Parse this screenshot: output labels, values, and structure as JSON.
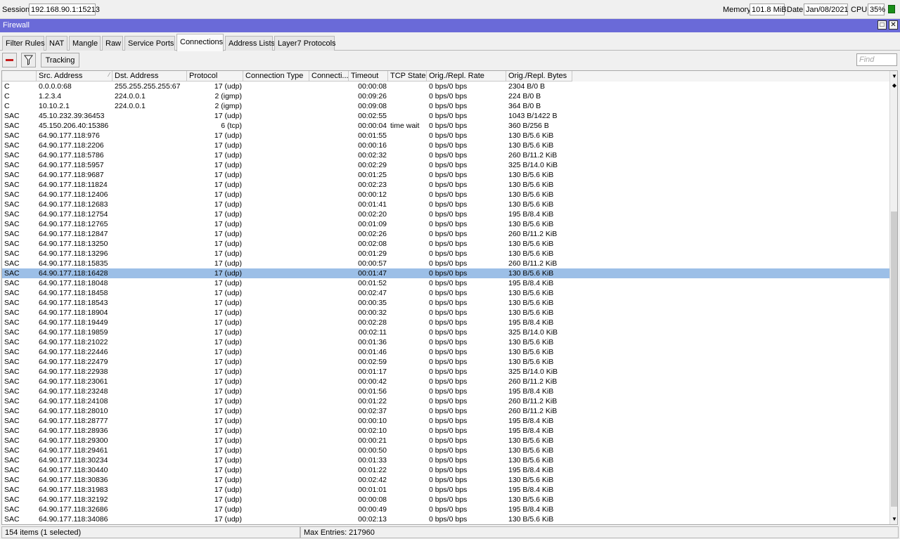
{
  "top": {
    "session_label": "Session:",
    "session_value": "192.168.90.1:15213",
    "memory_label": "Memory:",
    "memory_value": "101.8 MiB",
    "date_label": "Date:",
    "date_value": "Jan/08/2021",
    "cpu_label": "CPU:",
    "cpu_value": "35%"
  },
  "window": {
    "title": "Firewall"
  },
  "tabs": [
    {
      "label": "Filter Rules"
    },
    {
      "label": "NAT"
    },
    {
      "label": "Mangle"
    },
    {
      "label": "Raw"
    },
    {
      "label": "Service Ports"
    },
    {
      "label": "Connections"
    },
    {
      "label": "Address Lists"
    },
    {
      "label": "Layer7 Protocols"
    }
  ],
  "toolbar": {
    "tracking_label": "Tracking",
    "find_placeholder": "Find"
  },
  "columns": [
    "",
    "Src. Address",
    "Dst. Address",
    "Protocol",
    "Connection Type",
    "Connecti...",
    "Timeout",
    "TCP State",
    "Orig./Repl. Rate",
    "Orig./Repl. Bytes"
  ],
  "rows": [
    {
      "f": "C",
      "src": "0.0.0.0:68",
      "dst": "255.255.255.255:67",
      "proto": "17 (udp)",
      "tcp": "",
      "timeout": "00:00:08",
      "rate": "0 bps/0 bps",
      "bytes": "2304 B/0 B"
    },
    {
      "f": "C",
      "src": "1.2.3.4",
      "dst": "224.0.0.1",
      "proto": "2 (igmp)",
      "tcp": "",
      "timeout": "00:09:26",
      "rate": "0 bps/0 bps",
      "bytes": "224 B/0 B"
    },
    {
      "f": "C",
      "src": "10.10.2.1",
      "dst": "224.0.0.1",
      "proto": "2 (igmp)",
      "tcp": "",
      "timeout": "00:09:08",
      "rate": "0 bps/0 bps",
      "bytes": "364 B/0 B"
    },
    {
      "f": "SAC",
      "src": "45.10.232.39:36453",
      "dst": "",
      "proto": "17 (udp)",
      "tcp": "",
      "timeout": "00:02:55",
      "rate": "0 bps/0 bps",
      "bytes": "1043 B/1422 B"
    },
    {
      "f": "SAC",
      "src": "45.150.206.40:15386",
      "dst": "",
      "proto": "6 (tcp)",
      "tcp": "time wait",
      "timeout": "00:00:04",
      "rate": "0 bps/0 bps",
      "bytes": "360 B/256 B"
    },
    {
      "f": "SAC",
      "src": "64.90.177.118:976",
      "dst": "",
      "proto": "17 (udp)",
      "tcp": "",
      "timeout": "00:01:55",
      "rate": "0 bps/0 bps",
      "bytes": "130 B/5.6 KiB"
    },
    {
      "f": "SAC",
      "src": "64.90.177.118:2206",
      "dst": "",
      "proto": "17 (udp)",
      "tcp": "",
      "timeout": "00:00:16",
      "rate": "0 bps/0 bps",
      "bytes": "130 B/5.6 KiB"
    },
    {
      "f": "SAC",
      "src": "64.90.177.118:5786",
      "dst": "",
      "proto": "17 (udp)",
      "tcp": "",
      "timeout": "00:02:32",
      "rate": "0 bps/0 bps",
      "bytes": "260 B/11.2 KiB"
    },
    {
      "f": "SAC",
      "src": "64.90.177.118:5957",
      "dst": "",
      "proto": "17 (udp)",
      "tcp": "",
      "timeout": "00:02:29",
      "rate": "0 bps/0 bps",
      "bytes": "325 B/14.0 KiB"
    },
    {
      "f": "SAC",
      "src": "64.90.177.118:9687",
      "dst": "",
      "proto": "17 (udp)",
      "tcp": "",
      "timeout": "00:01:25",
      "rate": "0 bps/0 bps",
      "bytes": "130 B/5.6 KiB"
    },
    {
      "f": "SAC",
      "src": "64.90.177.118:11824",
      "dst": "",
      "proto": "17 (udp)",
      "tcp": "",
      "timeout": "00:02:23",
      "rate": "0 bps/0 bps",
      "bytes": "130 B/5.6 KiB"
    },
    {
      "f": "SAC",
      "src": "64.90.177.118:12406",
      "dst": "",
      "proto": "17 (udp)",
      "tcp": "",
      "timeout": "00:00:12",
      "rate": "0 bps/0 bps",
      "bytes": "130 B/5.6 KiB"
    },
    {
      "f": "SAC",
      "src": "64.90.177.118:12683",
      "dst": "",
      "proto": "17 (udp)",
      "tcp": "",
      "timeout": "00:01:41",
      "rate": "0 bps/0 bps",
      "bytes": "130 B/5.6 KiB"
    },
    {
      "f": "SAC",
      "src": "64.90.177.118:12754",
      "dst": "",
      "proto": "17 (udp)",
      "tcp": "",
      "timeout": "00:02:20",
      "rate": "0 bps/0 bps",
      "bytes": "195 B/8.4 KiB"
    },
    {
      "f": "SAC",
      "src": "64.90.177.118:12765",
      "dst": "",
      "proto": "17 (udp)",
      "tcp": "",
      "timeout": "00:01:09",
      "rate": "0 bps/0 bps",
      "bytes": "130 B/5.6 KiB"
    },
    {
      "f": "SAC",
      "src": "64.90.177.118:12847",
      "dst": "",
      "proto": "17 (udp)",
      "tcp": "",
      "timeout": "00:02:26",
      "rate": "0 bps/0 bps",
      "bytes": "260 B/11.2 KiB"
    },
    {
      "f": "SAC",
      "src": "64.90.177.118:13250",
      "dst": "",
      "proto": "17 (udp)",
      "tcp": "",
      "timeout": "00:02:08",
      "rate": "0 bps/0 bps",
      "bytes": "130 B/5.6 KiB"
    },
    {
      "f": "SAC",
      "src": "64.90.177.118:13296",
      "dst": "",
      "proto": "17 (udp)",
      "tcp": "",
      "timeout": "00:01:29",
      "rate": "0 bps/0 bps",
      "bytes": "130 B/5.6 KiB"
    },
    {
      "f": "SAC",
      "src": "64.90.177.118:15835",
      "dst": "",
      "proto": "17 (udp)",
      "tcp": "",
      "timeout": "00:00:57",
      "rate": "0 bps/0 bps",
      "bytes": "260 B/11.2 KiB"
    },
    {
      "f": "SAC",
      "src": "64.90.177.118:16428",
      "dst": "",
      "proto": "17 (udp)",
      "tcp": "",
      "timeout": "00:01:47",
      "rate": "0 bps/0 bps",
      "bytes": "130 B/5.6 KiB",
      "selected": true
    },
    {
      "f": "SAC",
      "src": "64.90.177.118:18048",
      "dst": "",
      "proto": "17 (udp)",
      "tcp": "",
      "timeout": "00:01:52",
      "rate": "0 bps/0 bps",
      "bytes": "195 B/8.4 KiB"
    },
    {
      "f": "SAC",
      "src": "64.90.177.118:18458",
      "dst": "",
      "proto": "17 (udp)",
      "tcp": "",
      "timeout": "00:02:47",
      "rate": "0 bps/0 bps",
      "bytes": "130 B/5.6 KiB"
    },
    {
      "f": "SAC",
      "src": "64.90.177.118:18543",
      "dst": "",
      "proto": "17 (udp)",
      "tcp": "",
      "timeout": "00:00:35",
      "rate": "0 bps/0 bps",
      "bytes": "130 B/5.6 KiB"
    },
    {
      "f": "SAC",
      "src": "64.90.177.118:18904",
      "dst": "",
      "proto": "17 (udp)",
      "tcp": "",
      "timeout": "00:00:32",
      "rate": "0 bps/0 bps",
      "bytes": "130 B/5.6 KiB"
    },
    {
      "f": "SAC",
      "src": "64.90.177.118:19449",
      "dst": "",
      "proto": "17 (udp)",
      "tcp": "",
      "timeout": "00:02:28",
      "rate": "0 bps/0 bps",
      "bytes": "195 B/8.4 KiB"
    },
    {
      "f": "SAC",
      "src": "64.90.177.118:19859",
      "dst": "",
      "proto": "17 (udp)",
      "tcp": "",
      "timeout": "00:02:11",
      "rate": "0 bps/0 bps",
      "bytes": "325 B/14.0 KiB"
    },
    {
      "f": "SAC",
      "src": "64.90.177.118:21022",
      "dst": "",
      "proto": "17 (udp)",
      "tcp": "",
      "timeout": "00:01:36",
      "rate": "0 bps/0 bps",
      "bytes": "130 B/5.6 KiB"
    },
    {
      "f": "SAC",
      "src": "64.90.177.118:22446",
      "dst": "",
      "proto": "17 (udp)",
      "tcp": "",
      "timeout": "00:01:46",
      "rate": "0 bps/0 bps",
      "bytes": "130 B/5.6 KiB"
    },
    {
      "f": "SAC",
      "src": "64.90.177.118:22479",
      "dst": "",
      "proto": "17 (udp)",
      "tcp": "",
      "timeout": "00:02:59",
      "rate": "0 bps/0 bps",
      "bytes": "130 B/5.6 KiB"
    },
    {
      "f": "SAC",
      "src": "64.90.177.118:22938",
      "dst": "",
      "proto": "17 (udp)",
      "tcp": "",
      "timeout": "00:01:17",
      "rate": "0 bps/0 bps",
      "bytes": "325 B/14.0 KiB"
    },
    {
      "f": "SAC",
      "src": "64.90.177.118:23061",
      "dst": "",
      "proto": "17 (udp)",
      "tcp": "",
      "timeout": "00:00:42",
      "rate": "0 bps/0 bps",
      "bytes": "260 B/11.2 KiB"
    },
    {
      "f": "SAC",
      "src": "64.90.177.118:23248",
      "dst": "",
      "proto": "17 (udp)",
      "tcp": "",
      "timeout": "00:01:56",
      "rate": "0 bps/0 bps",
      "bytes": "195 B/8.4 KiB"
    },
    {
      "f": "SAC",
      "src": "64.90.177.118:24108",
      "dst": "",
      "proto": "17 (udp)",
      "tcp": "",
      "timeout": "00:01:22",
      "rate": "0 bps/0 bps",
      "bytes": "260 B/11.2 KiB"
    },
    {
      "f": "SAC",
      "src": "64.90.177.118:28010",
      "dst": "",
      "proto": "17 (udp)",
      "tcp": "",
      "timeout": "00:02:37",
      "rate": "0 bps/0 bps",
      "bytes": "260 B/11.2 KiB"
    },
    {
      "f": "SAC",
      "src": "64.90.177.118:28777",
      "dst": "",
      "proto": "17 (udp)",
      "tcp": "",
      "timeout": "00:00:10",
      "rate": "0 bps/0 bps",
      "bytes": "195 B/8.4 KiB"
    },
    {
      "f": "SAC",
      "src": "64.90.177.118:28936",
      "dst": "",
      "proto": "17 (udp)",
      "tcp": "",
      "timeout": "00:02:10",
      "rate": "0 bps/0 bps",
      "bytes": "195 B/8.4 KiB"
    },
    {
      "f": "SAC",
      "src": "64.90.177.118:29300",
      "dst": "",
      "proto": "17 (udp)",
      "tcp": "",
      "timeout": "00:00:21",
      "rate": "0 bps/0 bps",
      "bytes": "130 B/5.6 KiB"
    },
    {
      "f": "SAC",
      "src": "64.90.177.118:29461",
      "dst": "",
      "proto": "17 (udp)",
      "tcp": "",
      "timeout": "00:00:50",
      "rate": "0 bps/0 bps",
      "bytes": "130 B/5.6 KiB"
    },
    {
      "f": "SAC",
      "src": "64.90.177.118:30234",
      "dst": "",
      "proto": "17 (udp)",
      "tcp": "",
      "timeout": "00:01:33",
      "rate": "0 bps/0 bps",
      "bytes": "130 B/5.6 KiB"
    },
    {
      "f": "SAC",
      "src": "64.90.177.118:30440",
      "dst": "",
      "proto": "17 (udp)",
      "tcp": "",
      "timeout": "00:01:22",
      "rate": "0 bps/0 bps",
      "bytes": "195 B/8.4 KiB"
    },
    {
      "f": "SAC",
      "src": "64.90.177.118:30836",
      "dst": "",
      "proto": "17 (udp)",
      "tcp": "",
      "timeout": "00:02:42",
      "rate": "0 bps/0 bps",
      "bytes": "130 B/5.6 KiB"
    },
    {
      "f": "SAC",
      "src": "64.90.177.118:31983",
      "dst": "",
      "proto": "17 (udp)",
      "tcp": "",
      "timeout": "00:01:01",
      "rate": "0 bps/0 bps",
      "bytes": "195 B/8.4 KiB"
    },
    {
      "f": "SAC",
      "src": "64.90.177.118:32192",
      "dst": "",
      "proto": "17 (udp)",
      "tcp": "",
      "timeout": "00:00:08",
      "rate": "0 bps/0 bps",
      "bytes": "130 B/5.6 KiB"
    },
    {
      "f": "SAC",
      "src": "64.90.177.118:32686",
      "dst": "",
      "proto": "17 (udp)",
      "tcp": "",
      "timeout": "00:00:49",
      "rate": "0 bps/0 bps",
      "bytes": "195 B/8.4 KiB"
    },
    {
      "f": "SAC",
      "src": "64.90.177.118:34086",
      "dst": "",
      "proto": "17 (udp)",
      "tcp": "",
      "timeout": "00:02:13",
      "rate": "0 bps/0 bps",
      "bytes": "130 B/5.6 KiB"
    }
  ],
  "status": {
    "items": "154 items (1 selected)",
    "max_entries": "Max Entries: 217960"
  },
  "colors": {
    "title_bar": "#6a6ad8",
    "selection": "#9cbfe7",
    "cpu_indicator": "#1a8f1a"
  }
}
